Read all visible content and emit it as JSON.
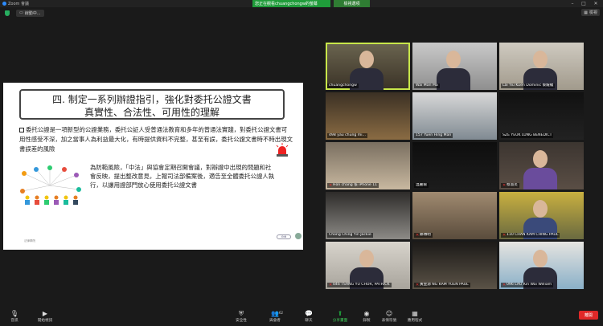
{
  "window": {
    "app_title": "Zoom 會議",
    "recording_banner": "您正在觀看chuangchongw的螢幕",
    "share_options": "檢視選項"
  },
  "infobar": {
    "viewing_label": "線動中...",
    "view_button": "檢視"
  },
  "slide": {
    "title_line1": "四. 制定一系列辦證指引，強化對委托公證文書",
    "title_line2": "真實性、合法性、可用性的理解",
    "para1": "委托公證是一項新型的公證業務，委托公証人受普通法教育和多年的普通法實踐，對委托公證文書可用性感受不深，加之當事人為利益最大化，有時提供資料不完整，甚至有誤，委托公證文書時不時出現文書誤差的風險",
    "para2": "為防範風險，「中法」與協會定期召開會議，對辦證中出現的問題和社會反映，提出整改意見，上報司法部備案後，適告至全體委托公證人執行，以讓用證部門放心使用委托公證文書",
    "footer": "法律學院",
    "ctrl_label": "⊖⊕"
  },
  "participants": [
    {
      "name": "chuangchongw",
      "muted": false,
      "active": true
    },
    {
      "name": "Wai Man Ma",
      "muted": false,
      "active": false
    },
    {
      "name": "Lai Yiu Kuen Dominic 黎耀權",
      "muted": false,
      "active": false
    },
    {
      "name": "498 yau chung mi...",
      "muted": false,
      "active": false
    },
    {
      "name": "157 Yuen Hing Man",
      "muted": false,
      "active": false
    },
    {
      "name": "SZE YEUK LUNG BENEDICT",
      "muted": false,
      "active": false
    },
    {
      "name": "Hon chang 張 iPhone 11",
      "muted": true,
      "active": false
    },
    {
      "name": "溫麗瑜",
      "muted": false,
      "active": false
    },
    {
      "name": "蔡淑炎",
      "muted": true,
      "active": false
    },
    {
      "name": "Chong Ching Yin Jackie",
      "muted": false,
      "active": false
    },
    {
      "name": "鄭傳明",
      "muted": true,
      "active": false
    },
    {
      "name": "110 CHAN KAM CHING PAUL",
      "muted": true,
      "active": false
    },
    {
      "name": "046 TSANG YU CHOR, PATRICK",
      "muted": true,
      "active": false
    },
    {
      "name": "黃金源 NG KAM YUEN PAUL",
      "muted": true,
      "active": false
    },
    {
      "name": "096 LAU Kin Wai William",
      "muted": true,
      "active": false
    }
  ],
  "toolbar": {
    "audio": "音訊",
    "video": "開始視訊",
    "security": "安全性",
    "participants": "與會者",
    "participants_count": "62",
    "chat": "聊天",
    "share": "分享畫面",
    "record": "錄製",
    "reactions": "表情符號",
    "apps": "應用程式",
    "end": "離開"
  },
  "colors": {
    "active_speaker": "#c8e64a",
    "share_green": "#1f9c3a",
    "end_red": "#e02828",
    "mute_red": "#e33333"
  }
}
